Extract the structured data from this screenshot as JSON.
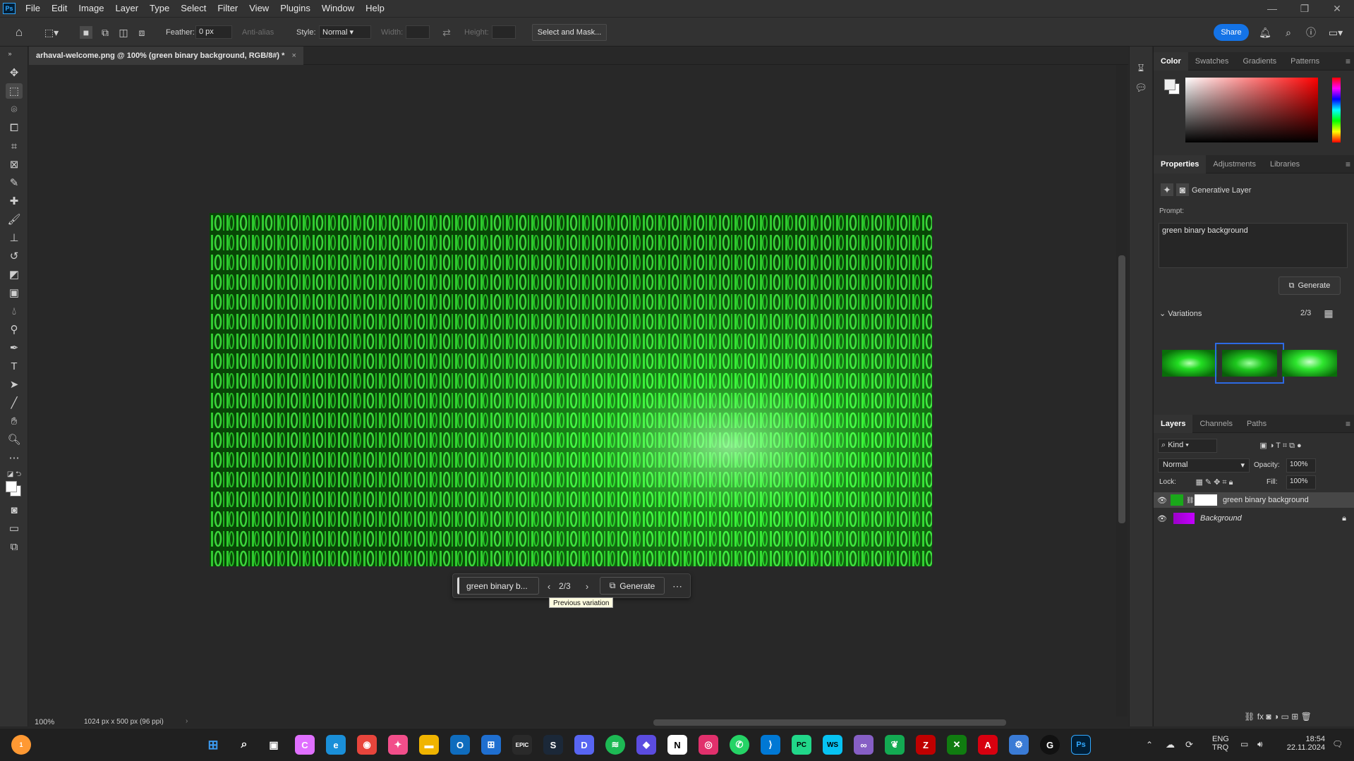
{
  "menubar": {
    "logo": "Ps",
    "items": [
      "File",
      "Edit",
      "Image",
      "Layer",
      "Type",
      "Select",
      "Filter",
      "View",
      "Plugins",
      "Window",
      "Help"
    ]
  },
  "options": {
    "feather_label": "Feather:",
    "feather_value": "0 px",
    "antialias_label": "Anti-alias",
    "style_label": "Style:",
    "style_value": "Normal",
    "width_label": "Width:",
    "height_label": "Height:",
    "select_mask": "Select and Mask...",
    "share": "Share"
  },
  "doc": {
    "tab_title": "arhaval-welcome.png @ 100% (green binary background, RGB/8#) *",
    "zoom": "100%",
    "info": "1024 px x 500 px (96 ppi)"
  },
  "context_bar": {
    "prompt": "green binary b...",
    "counter": "2/3",
    "generate": "Generate",
    "tooltip": "Previous variation"
  },
  "color_panel": {
    "tabs": [
      "Color",
      "Swatches",
      "Gradients",
      "Patterns"
    ],
    "active": "Color"
  },
  "properties": {
    "tabs": [
      "Properties",
      "Adjustments",
      "Libraries"
    ],
    "active": "Properties",
    "layer_type": "Generative Layer",
    "prompt_label": "Prompt:",
    "prompt_text": "green binary background",
    "generate": "Generate",
    "variations_label": "Variations",
    "variations_count": "2/3",
    "selected_variation": 2
  },
  "layers": {
    "tabs": [
      "Layers",
      "Channels",
      "Paths"
    ],
    "active": "Layers",
    "filter": "Kind",
    "blend": "Normal",
    "opacity_label": "Opacity:",
    "opacity": "100%",
    "lock_label": "Lock:",
    "fill_label": "Fill:",
    "fill": "100%",
    "items": [
      {
        "name": "green binary background",
        "visible": true,
        "selected": true
      },
      {
        "name": "Background",
        "visible": true,
        "locked": true
      }
    ]
  },
  "taskbar": {
    "time": "18:54",
    "date": "22.11.2024",
    "lang1": "ENG",
    "lang2": "TRQ",
    "notif_badge": "1",
    "apps": [
      "start",
      "search",
      "explorer-view",
      "copilot",
      "edge",
      "chrome",
      "app-pink",
      "files",
      "outlook",
      "store",
      "epic",
      "steam",
      "discord",
      "spotify",
      "vector",
      "notion",
      "instagram",
      "whatsapp",
      "vscode",
      "pycharm",
      "webstorm",
      "visualstudio",
      "app-leaf",
      "filezilla",
      "xbox",
      "acrobat",
      "settings",
      "github",
      "photoshop"
    ]
  },
  "colors": {
    "accent": "#1473e6",
    "ps_blue": "#31a8ff",
    "matrix_green": "#22ee22"
  }
}
